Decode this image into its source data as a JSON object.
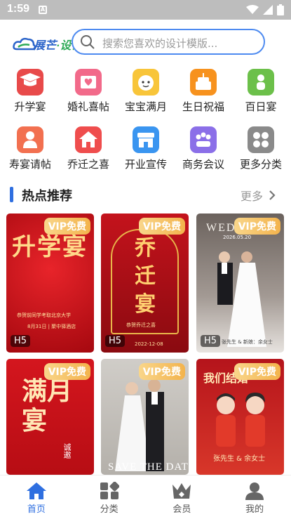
{
  "status_bar": {
    "time": "1:59",
    "notif_letter": "A"
  },
  "header": {
    "logo_text_main": "展芒",
    "logo_text_sub": "·设计",
    "search_placeholder": "搜索您喜欢的设计模版..."
  },
  "categories": [
    {
      "label": "升学宴",
      "color": "#e84a4a",
      "icon": "graduation-cap-icon"
    },
    {
      "label": "婚礼喜帖",
      "color": "#f26a8a",
      "icon": "wedding-card-icon"
    },
    {
      "label": "宝宝满月",
      "color": "#f8c53a",
      "icon": "baby-face-icon"
    },
    {
      "label": "生日祝福",
      "color": "#f7921e",
      "icon": "cake-icon"
    },
    {
      "label": "百日宴",
      "color": "#6cc04a",
      "icon": "baby-icon"
    },
    {
      "label": "寿宴请帖",
      "color": "#f27050",
      "icon": "elder-icon"
    },
    {
      "label": "乔迁之喜",
      "color": "#ef4d4d",
      "icon": "house-icon"
    },
    {
      "label": "开业宣传",
      "color": "#3a95f0",
      "icon": "store-icon"
    },
    {
      "label": "商务会议",
      "color": "#8b6fe8",
      "icon": "meeting-icon"
    },
    {
      "label": "更多分类",
      "color": "#8a8a8a",
      "icon": "grid-more-icon"
    }
  ],
  "section": {
    "title": "热点推荐",
    "more": "更多"
  },
  "cards": [
    {
      "vip": "VIP免费",
      "badge": "H5",
      "title": "升学宴",
      "small": "恭贺前同学考取北京大学",
      "date": "8月31日 | 聚中驿酒店"
    },
    {
      "vip": "VIP免费",
      "badge": "H5",
      "title": "乔迁宴",
      "small": "恭贺乔迁之喜",
      "date": "2022-12-08"
    },
    {
      "vip": "VIP免费",
      "badge": "H5",
      "title": "WEDDING",
      "small": "张先生 & 新娘：余女士",
      "date": "2026.05.20"
    },
    {
      "vip": "VIP免费",
      "badge": "",
      "title": "满月宴",
      "small": "诚邀",
      "date": ""
    },
    {
      "vip": "VIP免费",
      "badge": "",
      "title": "SAVE THE DATE",
      "small": "",
      "date": ""
    },
    {
      "vip": "VIP免费",
      "badge": "",
      "title": "我们结婚",
      "small": "张先生 & 余女士",
      "date": ""
    }
  ],
  "bottom_nav": [
    {
      "label": "首页",
      "active": true
    },
    {
      "label": "分类",
      "active": false
    },
    {
      "label": "会员",
      "active": false
    },
    {
      "label": "我的",
      "active": false
    }
  ],
  "colors": {
    "accent": "#2f6fe0",
    "vip": "#f3b34c"
  }
}
